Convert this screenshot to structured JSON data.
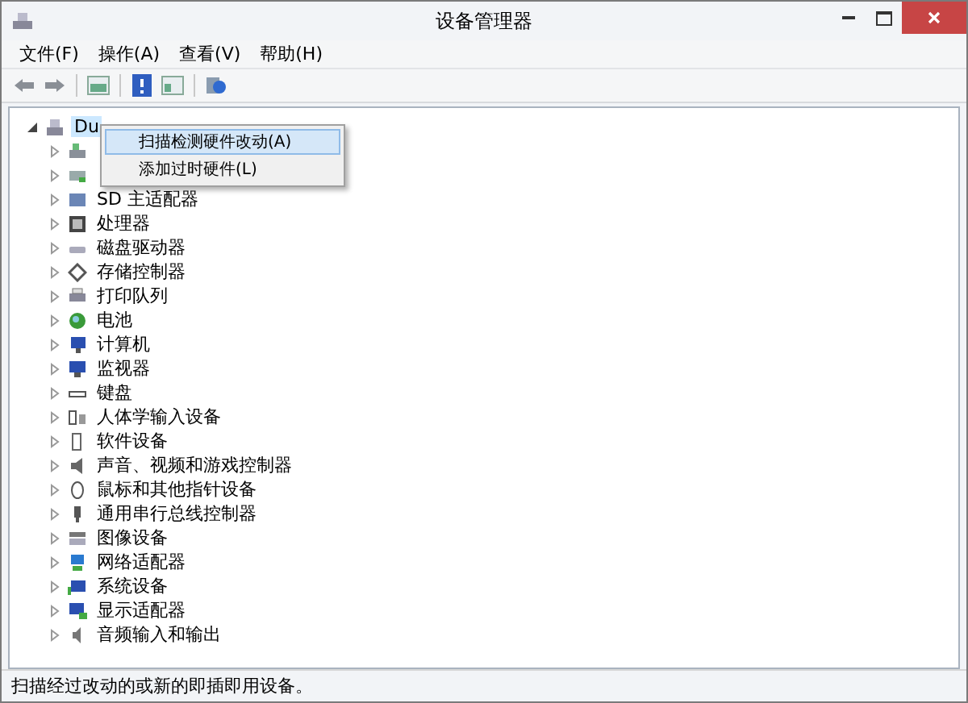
{
  "window": {
    "title": "设备管理器"
  },
  "menu": [
    {
      "label": "文件(F)"
    },
    {
      "label": "操作(A)"
    },
    {
      "label": "查看(V)"
    },
    {
      "label": "帮助(H)"
    }
  ],
  "tree": {
    "label": "Du",
    "expanded": true,
    "selected": true,
    "children": [
      {
        "expanded": false
      },
      {
        "expanded": false
      },
      {
        "label": "SD 主适配器",
        "expanded": false
      },
      {
        "label": "处理器",
        "expanded": false
      },
      {
        "label": "磁盘驱动器",
        "expanded": false
      },
      {
        "label": "存储控制器",
        "expanded": false
      },
      {
        "label": "打印队列",
        "expanded": false
      },
      {
        "label": "电池",
        "expanded": false
      },
      {
        "label": "计算机",
        "expanded": false
      },
      {
        "label": "监视器",
        "expanded": false
      },
      {
        "label": "键盘",
        "expanded": false
      },
      {
        "label": "人体学输入设备",
        "expanded": false
      },
      {
        "label": "软件设备",
        "expanded": false
      },
      {
        "label": "声音、视频和游戏控制器",
        "expanded": false
      },
      {
        "label": "鼠标和其他指针设备",
        "expanded": false
      },
      {
        "label": "通用串行总线控制器",
        "expanded": false
      },
      {
        "label": "图像设备",
        "expanded": false
      },
      {
        "label": "网络适配器",
        "expanded": false
      },
      {
        "label": "系统设备",
        "expanded": false
      },
      {
        "label": "显示适配器",
        "expanded": false
      },
      {
        "label": "音频输入和输出",
        "expanded": false
      }
    ]
  },
  "context_menu": [
    {
      "label": "扫描检测硬件改动(A)",
      "selected": true
    },
    {
      "label": "添加过时硬件(L)",
      "selected": false
    }
  ],
  "status_bar": "扫描经过改动的或新的即插即用设备。"
}
